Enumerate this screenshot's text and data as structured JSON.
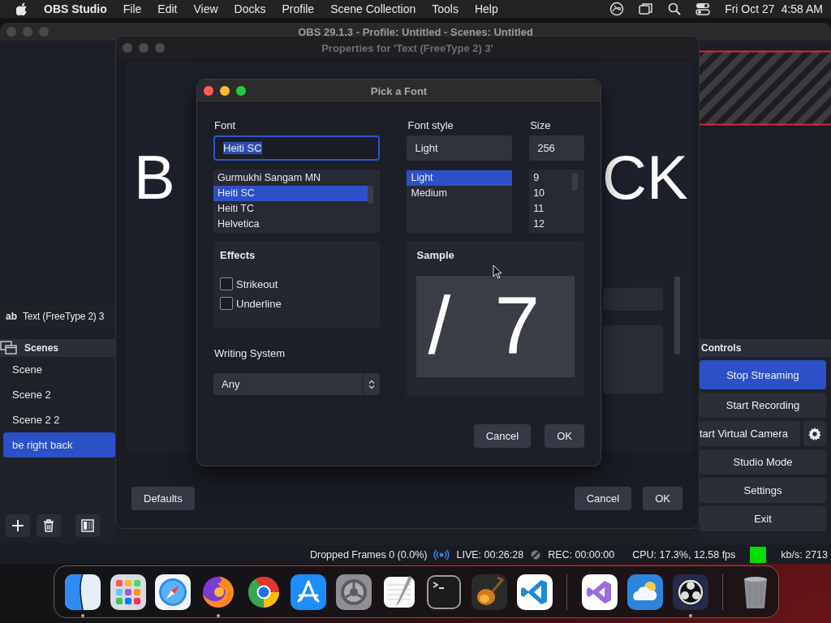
{
  "menu_bar": {
    "app_name": "OBS Studio",
    "menus": [
      "File",
      "Edit",
      "View",
      "Docks",
      "Profile",
      "Scene Collection",
      "Tools",
      "Help"
    ],
    "date": "Fri Oct 27",
    "time": "4:58 AM"
  },
  "main_window": {
    "title": "OBS 29.1.3 - Profile: Untitled - Scenes: Untitled",
    "source": {
      "type_label": "ab",
      "name": "Text (FreeType 2) 3"
    },
    "scenes_dock": {
      "title": "Scenes",
      "scenes": [
        {
          "name": "Scene",
          "selected": false
        },
        {
          "name": "Scene 2",
          "selected": false
        },
        {
          "name": "Scene 2 2",
          "selected": false
        },
        {
          "name": "be right back",
          "selected": true
        }
      ]
    },
    "controls_dock": {
      "title": "Controls",
      "buttons": [
        {
          "label": "Stop Streaming",
          "kind": "plain",
          "checked": true
        },
        {
          "label": "Start Recording",
          "kind": "plain",
          "checked": false
        },
        {
          "label": "tart Virtual Camera",
          "kind": "with_gear",
          "checked": false
        },
        {
          "label": "Studio Mode",
          "kind": "plain",
          "checked": false
        },
        {
          "label": "Settings",
          "kind": "plain",
          "checked": false
        },
        {
          "label": "Exit",
          "kind": "plain",
          "checked": false
        }
      ]
    },
    "status_bar": {
      "dropped_frames": "Dropped Frames 0 (0.0%)",
      "live": "LIVE: 00:26:28",
      "rec": "REC: 00:00:00",
      "cpu": "CPU: 17.3%, 12.58 fps",
      "bitrate": "kb/s: 2713"
    }
  },
  "properties_window": {
    "title": "Properties for 'Text (FreeType 2) 3'",
    "preview_text_fragments": [
      "B",
      "CK"
    ],
    "buttons": [
      "Defaults",
      "Cancel",
      "OK"
    ]
  },
  "font_dialog": {
    "title": "Pick a Font",
    "font": {
      "label": "Font",
      "value": "Heiti SC",
      "items": [
        {
          "name": "Gurmukhi Sangam MN",
          "selected": false
        },
        {
          "name": "Heiti SC",
          "selected": true
        },
        {
          "name": "Heiti TC",
          "selected": false
        },
        {
          "name": "Helvetica",
          "selected": false
        }
      ]
    },
    "style": {
      "label": "Font style",
      "value": "Light",
      "items": [
        {
          "name": "Light",
          "selected": true
        },
        {
          "name": "Medium",
          "selected": false
        }
      ]
    },
    "size": {
      "label": "Size",
      "value": "256",
      "items": [
        {
          "name": "9",
          "selected": false
        },
        {
          "name": "10",
          "selected": false
        },
        {
          "name": "11",
          "selected": false
        },
        {
          "name": "12",
          "selected": false
        }
      ]
    },
    "effects": {
      "title": "Effects",
      "options": [
        {
          "label": "Strikeout",
          "checked": false
        },
        {
          "label": "Underline",
          "checked": false
        }
      ]
    },
    "sample": {
      "title": "Sample",
      "glyphs": [
        "/",
        "7"
      ]
    },
    "writing_system": {
      "label": "Writing System",
      "value": "Any"
    },
    "buttons": [
      "Cancel",
      "OK"
    ]
  },
  "dock": [
    {
      "kind": "app",
      "running": true
    },
    {
      "kind": "app",
      "running": false
    },
    {
      "kind": "app",
      "running": false
    },
    {
      "kind": "app",
      "running": true
    },
    {
      "kind": "app",
      "running": false
    },
    {
      "kind": "app",
      "running": false
    },
    {
      "kind": "app",
      "running": false
    },
    {
      "kind": "app",
      "running": false
    },
    {
      "kind": "app",
      "running": false
    },
    {
      "kind": "app",
      "running": false
    },
    {
      "kind": "app",
      "running": false
    },
    {
      "kind": "separator"
    },
    {
      "kind": "app",
      "running": false
    },
    {
      "kind": "app",
      "running": false
    },
    {
      "kind": "app",
      "running": true
    },
    {
      "kind": "separator"
    },
    {
      "kind": "app",
      "running": false
    }
  ]
}
